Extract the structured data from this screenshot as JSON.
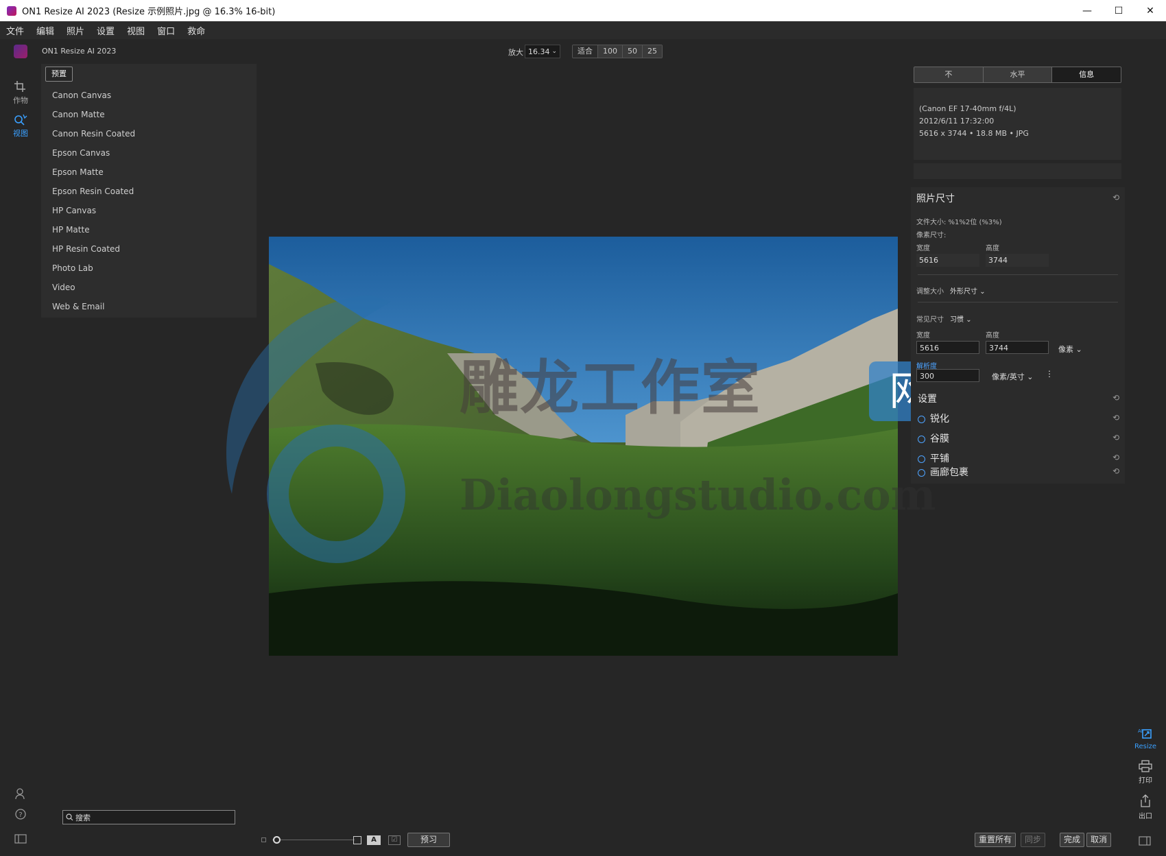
{
  "window": {
    "title": "ON1 Resize AI 2023 (Resize 示例照片.jpg @ 16.3% 16-bit)",
    "minimize": "—",
    "maximize": "☐",
    "close": "✕"
  },
  "menu": [
    "文件",
    "编辑",
    "照片",
    "设置",
    "视图",
    "窗口",
    "救命"
  ],
  "app": {
    "name": "ON1 Resize AI 2023",
    "logo_icon": "on1-logo-icon"
  },
  "zoom": {
    "label": "放大",
    "value": "16.34",
    "presets": [
      "适合",
      "100",
      "50",
      "25"
    ]
  },
  "left_strip": {
    "crop_label": "作物",
    "view_label": "视图",
    "accent": "#3aa0ff"
  },
  "presets": {
    "tab": "预置",
    "items": [
      "Canon Canvas",
      "Canon Matte",
      "Canon Resin Coated",
      "Epson Canvas",
      "Epson Matte",
      "Epson Resin Coated",
      "HP Canvas",
      "HP Matte",
      "HP Resin Coated",
      "Photo Lab",
      "Video",
      "Web & Email"
    ]
  },
  "search": {
    "placeholder": "搜索"
  },
  "right_panel": {
    "tabs": [
      "不",
      "水平",
      "信息"
    ],
    "info": {
      "lens": "(Canon EF 17-40mm f/4L)",
      "datetime": "2012/6/11  17:32:00",
      "dims": "5616 x 3744 • 18.8 MB • JPG"
    },
    "photo_size": {
      "title": "照片尺寸",
      "file_size": "文件大小: %1%2位 (%3%)",
      "pixel_dims": "像素尺寸:",
      "width_label": "宽度",
      "height_label": "高度",
      "width_value": "5616",
      "height_value": "3744",
      "resize_label": "调整大小",
      "resize_mode": "外形尺寸",
      "common_label": "常见尺寸",
      "common_value": "习惯",
      "width2_label": "宽度",
      "height2_label": "高度",
      "width2_value": "5616",
      "height2_value": "3744",
      "unit": "像素",
      "resolution_label": "解析度",
      "resolution_value": "300",
      "res_unit": "像素/英寸"
    },
    "sections": [
      "设置",
      "锐化",
      "谷膜",
      "平铺",
      "画廊包裹"
    ]
  },
  "right_strip": {
    "resize_label": "Resize",
    "print_label": "打印",
    "export_label": "出口"
  },
  "bottom": {
    "preview": "预习",
    "reset_all": "重置所有",
    "sync": "同步",
    "done": "完成",
    "cancel": "取消"
  },
  "watermark": {
    "text1": "雕龙工作室",
    "badge": "网站",
    "text2": "Diaolongstudio.com"
  }
}
